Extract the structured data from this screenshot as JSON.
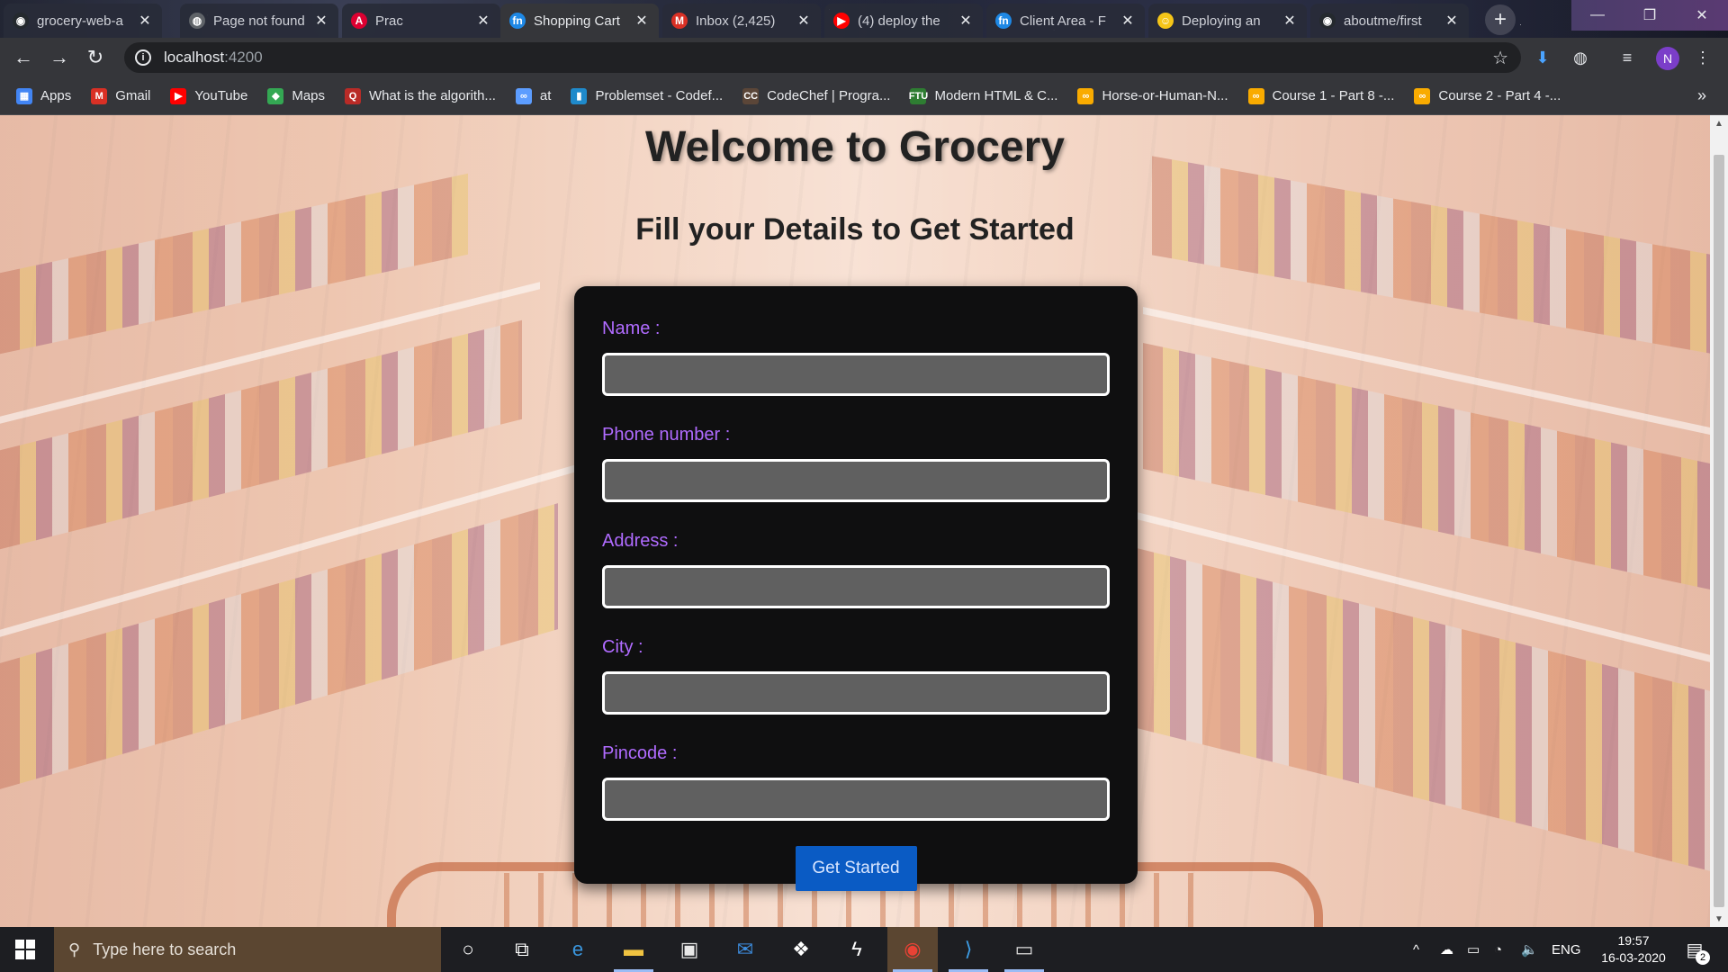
{
  "browser": {
    "tabs": [
      {
        "title": "grocery-web-a",
        "favicon": "github-icon",
        "color": "#24292e",
        "glyph": "◉"
      },
      {
        "title": "Page not found",
        "favicon": "globe-icon",
        "color": "#5f6368",
        "glyph": "◍"
      },
      {
        "title": "Prac",
        "favicon": "angular-icon",
        "color": "#dd0031",
        "glyph": "A"
      },
      {
        "title": "Shopping Cart",
        "favicon": "fn-icon",
        "color": "#1e88e5",
        "glyph": "fn"
      },
      {
        "title": "Inbox (2,425)",
        "favicon": "gmail-icon",
        "color": "#d93025",
        "glyph": "M"
      },
      {
        "title": "(4) deploy the",
        "favicon": "youtube-icon",
        "color": "#ff0000",
        "glyph": "▶"
      },
      {
        "title": "Client Area - F",
        "favicon": "fn-icon",
        "color": "#1e88e5",
        "glyph": "fn"
      },
      {
        "title": "Deploying an",
        "favicon": "emoji-icon",
        "color": "#f5c518",
        "glyph": "☺"
      },
      {
        "title": "aboutme/first",
        "favicon": "github-icon",
        "color": "#24292e",
        "glyph": "◉"
      }
    ],
    "active_tab": 3,
    "new_tab_label": "+",
    "close_glyph": "✕",
    "address": {
      "host": "localhost",
      "port": ":4200"
    },
    "profile_initial": "N"
  },
  "bookmarks": [
    {
      "label": "Apps",
      "icon": "apps-grid-icon",
      "color": "#4285f4",
      "glyph": "▦"
    },
    {
      "label": "Gmail",
      "icon": "gmail-icon",
      "color": "#d93025",
      "glyph": "M"
    },
    {
      "label": "YouTube",
      "icon": "youtube-icon",
      "color": "#ff0000",
      "glyph": "▶"
    },
    {
      "label": "Maps",
      "icon": "maps-icon",
      "color": "#34a853",
      "glyph": "◆"
    },
    {
      "label": "What is the algorith...",
      "icon": "quora-icon",
      "color": "#b92b27",
      "glyph": "Q"
    },
    {
      "label": "at",
      "icon": "infinity-icon",
      "color": "#5c9dff",
      "glyph": "∞"
    },
    {
      "label": "Problemset - Codef...",
      "icon": "codeforces-icon",
      "color": "#1f8acb",
      "glyph": "▮"
    },
    {
      "label": "CodeChef | Progra...",
      "icon": "codechef-icon",
      "color": "#5b4638",
      "glyph": "CC"
    },
    {
      "label": "Modern HTML & C...",
      "icon": "ftu-icon",
      "color": "#2e7d32",
      "glyph": "FTU"
    },
    {
      "label": "Horse-or-Human-N...",
      "icon": "colab-icon",
      "color": "#f9ab00",
      "glyph": "∞"
    },
    {
      "label": "Course 1 - Part 8 -...",
      "icon": "colab-icon",
      "color": "#f9ab00",
      "glyph": "∞"
    },
    {
      "label": "Course 2 - Part 4 -...",
      "icon": "colab-icon",
      "color": "#f9ab00",
      "glyph": "∞"
    }
  ],
  "page": {
    "title": "Welcome to Grocery",
    "subtitle": "Fill your Details to Get Started",
    "form": {
      "fields": [
        {
          "label": "Name :",
          "value": ""
        },
        {
          "label": "Phone number :",
          "value": ""
        },
        {
          "label": "Address :",
          "value": ""
        },
        {
          "label": "City :",
          "value": ""
        },
        {
          "label": "Pincode :",
          "value": ""
        }
      ],
      "submit_label": "Get Started"
    },
    "colors": {
      "label": "#b06bff",
      "button": "#0a5bc4",
      "card": "#0f0f10"
    }
  },
  "taskbar": {
    "search_placeholder": "Type here to search",
    "language": "ENG",
    "time": "19:57",
    "date": "16-03-2020",
    "notifications": "2"
  }
}
